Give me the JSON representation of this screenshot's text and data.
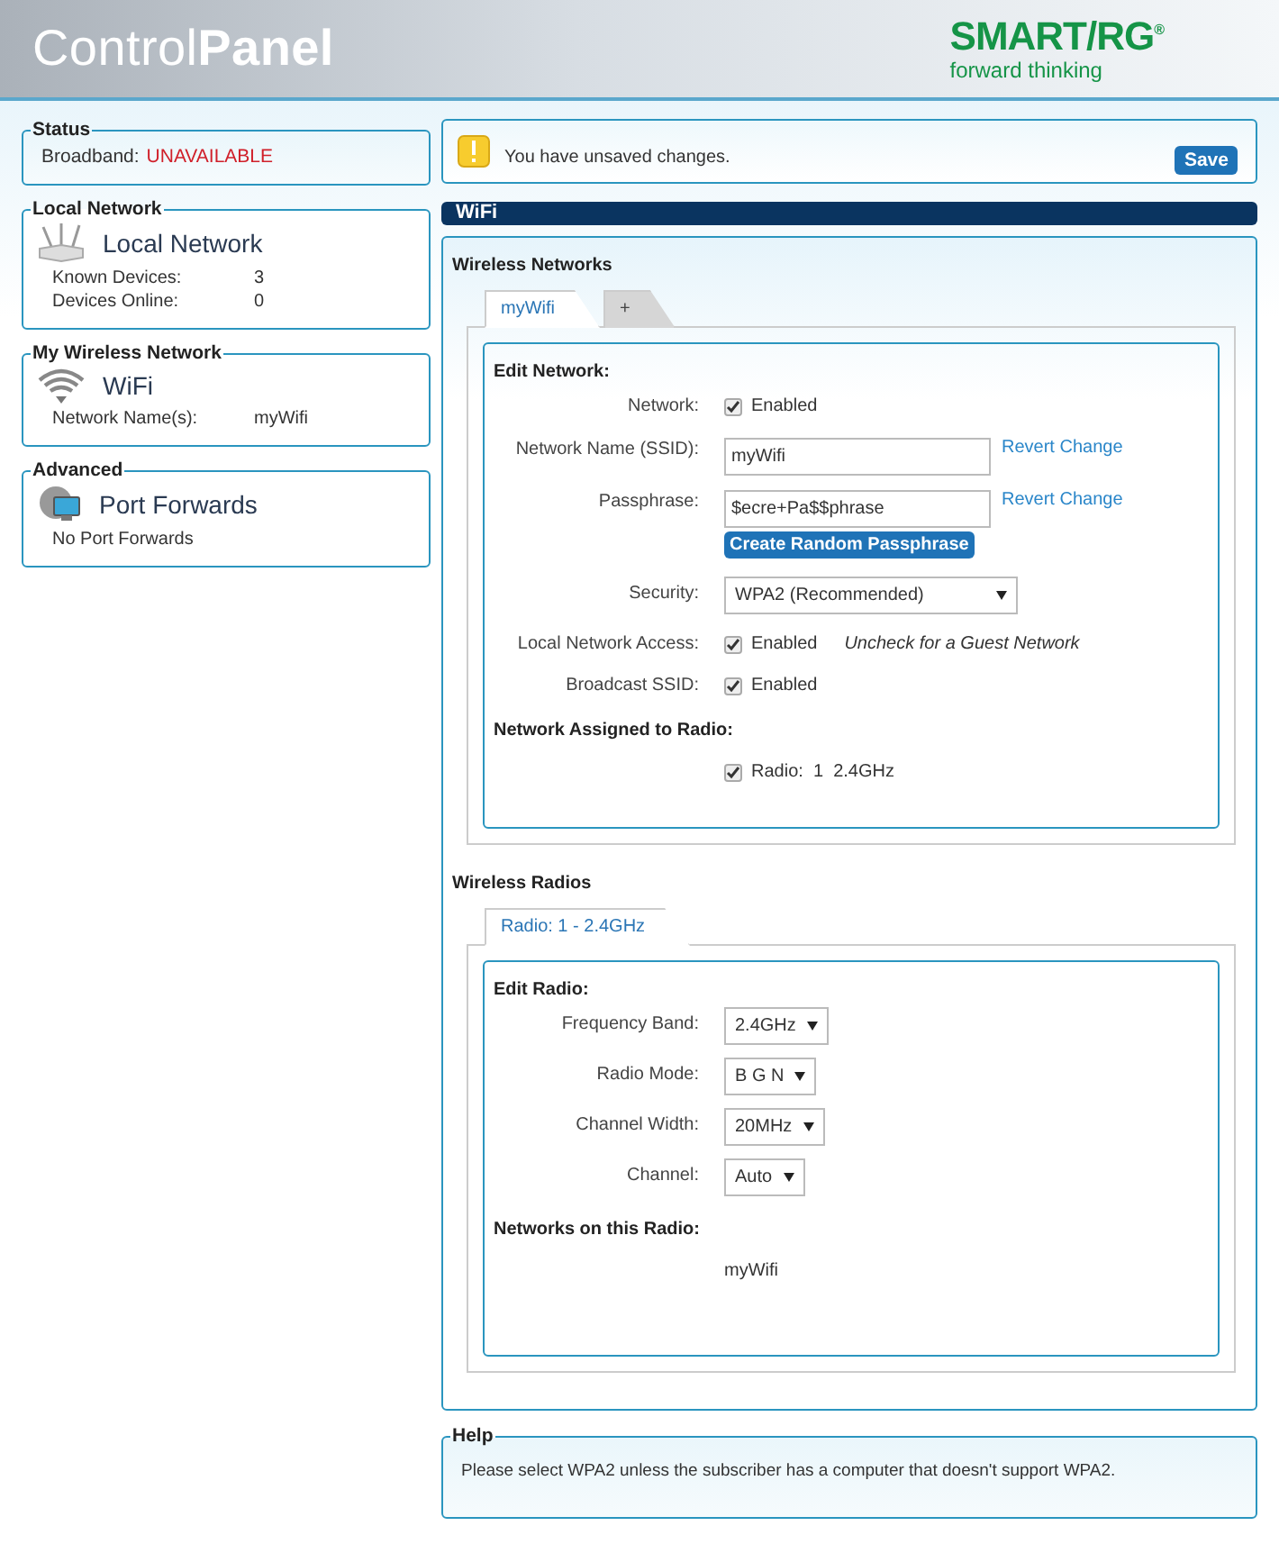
{
  "header": {
    "title": "Control**Panel**",
    "logo": {
      "name": "SMART/RG",
      "mark": "®",
      "tagline": "forward thinking"
    }
  },
  "sidebar": [
    {
      "kind": "status",
      "legend": "Status",
      "label": "Broadband:",
      "value": "UNAVAILABLE"
    },
    {
      "kind": "card",
      "legend": "Local Network",
      "title": "Local Network",
      "rows": [
        {
          "label": "Known Devices:",
          "value": "3"
        },
        {
          "label": "Devices Online:",
          "value": "0"
        }
      ]
    },
    {
      "kind": "card",
      "legend": "My Wireless Network",
      "title": "WiFi",
      "rows": [
        {
          "label": "Network Name(s):",
          "value": "myWifi"
        }
      ]
    },
    {
      "kind": "card",
      "legend": "Advanced",
      "title": "Port Forwards",
      "note": "No Port Forwards"
    }
  ],
  "alert": {
    "message": "You have unsaved changes.",
    "save": "Save"
  },
  "wifi": {
    "heading": "WiFi",
    "sections": [
      {
        "heading": "Wireless Networks",
        "tabs": [
          {
            "label": "myWifi",
            "selected": true
          },
          {
            "label": "+",
            "selected": false
          }
        ],
        "form_heading": "Edit Network:",
        "rows": [
          {
            "kind": "check",
            "label": "Network:",
            "checked": true,
            "text": "Enabled"
          },
          {
            "kind": "input",
            "label": "Network Name (SSID):",
            "value": "myWifi",
            "link": "Revert Change"
          },
          {
            "kind": "input",
            "label": "Passphrase:",
            "value": "$ecre+Pa$$phrase",
            "link": "Revert Change",
            "button": "Create Random Passphrase"
          },
          {
            "kind": "select",
            "label": "Security:",
            "value": "WPA2 (Recommended)",
            "wide": true
          },
          {
            "kind": "check",
            "label": "Local Network Access:",
            "checked": true,
            "text": "Enabled",
            "hint": "Uncheck for a Guest Network"
          },
          {
            "kind": "check",
            "label": "Broadcast SSID:",
            "checked": true,
            "text": "Enabled"
          },
          {
            "kind": "subheading",
            "text": "Network Assigned to Radio:"
          },
          {
            "kind": "check",
            "checked": true,
            "text": "Radio:  1  2.4GHz"
          }
        ]
      },
      {
        "heading": "Wireless Radios",
        "tabs": [
          {
            "label": "Radio: 1 - 2.4GHz",
            "selected": true
          }
        ],
        "form_heading": "Edit Radio:",
        "rows": [
          {
            "kind": "select",
            "label": "Frequency Band:",
            "value": "2.4GHz"
          },
          {
            "kind": "select",
            "label": "Radio Mode:",
            "value": "B G N"
          },
          {
            "kind": "select",
            "label": "Channel Width:",
            "value": "20MHz"
          },
          {
            "kind": "select",
            "label": "Channel:",
            "value": "Auto"
          },
          {
            "kind": "subheading",
            "text": "Networks on this Radio:"
          },
          {
            "kind": "text",
            "text": "myWifi"
          }
        ]
      }
    ]
  },
  "help": {
    "legend": "Help",
    "text": "Please select WPA2 unless the subscriber has a computer that doesn't support WPA2."
  }
}
